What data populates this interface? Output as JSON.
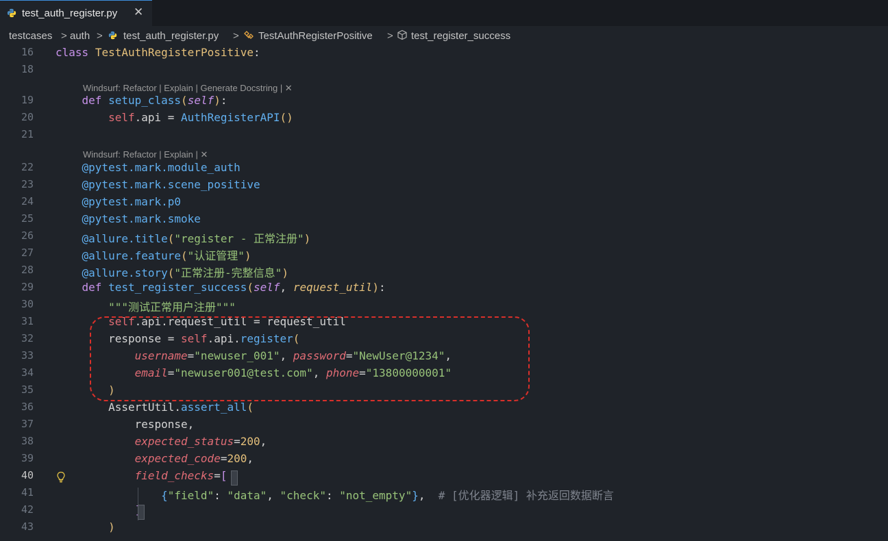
{
  "tab": {
    "title": "test_auth_register.py",
    "close": "✕"
  },
  "breadcrumb": {
    "folder1": "testcases",
    "folder2": "auth",
    "file": "test_auth_register.py",
    "class": "TestAuthRegisterPositive",
    "method": "test_register_success",
    "sep": ">"
  },
  "codelens": {
    "setup": "Windsurf: Refactor | Explain | Generate Docstring | ✕",
    "test": "Windsurf: Refactor | Explain | ✕"
  },
  "lines": {
    "l16": {
      "num": "16"
    },
    "l18": {
      "num": "18"
    },
    "l19": {
      "num": "19"
    },
    "l20": {
      "num": "20"
    },
    "l21": {
      "num": "21"
    },
    "l22": {
      "num": "22"
    },
    "l23": {
      "num": "23"
    },
    "l24": {
      "num": "24"
    },
    "l25": {
      "num": "25"
    },
    "l26": {
      "num": "26"
    },
    "l27": {
      "num": "27"
    },
    "l28": {
      "num": "28"
    },
    "l29": {
      "num": "29"
    },
    "l30": {
      "num": "30"
    },
    "l31": {
      "num": "31"
    },
    "l32": {
      "num": "32"
    },
    "l33": {
      "num": "33"
    },
    "l34": {
      "num": "34"
    },
    "l35": {
      "num": "35"
    },
    "l36": {
      "num": "36"
    },
    "l37": {
      "num": "37"
    },
    "l38": {
      "num": "38"
    },
    "l39": {
      "num": "39"
    },
    "l40": {
      "num": "40"
    },
    "l41": {
      "num": "41"
    },
    "l42": {
      "num": "42"
    },
    "l43": {
      "num": "43"
    }
  },
  "code": {
    "class_kw": "class",
    "class_name": "TestAuthRegisterPositive",
    "colon": ":",
    "def_kw": "def",
    "setup_name": "setup_class",
    "self_param": "self",
    "self_kw": "self",
    "api_attr": ".api = ",
    "api_class": "AuthRegisterAPI",
    "parens": "()",
    "dec1": "@pytest.mark.module_auth",
    "dec2": "@pytest.mark.scene_positive",
    "dec3": "@pytest.mark.p0",
    "dec4": "@pytest.mark.smoke",
    "dec5_name": "@allure.title",
    "dec5_arg": "\"register - 正常注册\"",
    "dec6_name": "@allure.feature",
    "dec6_arg": "\"认证管理\"",
    "dec7_name": "@allure.story",
    "dec7_arg": "\"正常注册-完整信息\"",
    "test_name": "test_register_success",
    "request_util_param": "request_util",
    "docstring": "\"\"\"测试正常用户注册\"\"\"",
    "line31_rest": ".api.request_util = request_util",
    "response_assign": "response = ",
    "api_dot": ".api.",
    "register_fn": "register",
    "username_kw": "username",
    "username_val": "\"newuser_001\"",
    "password_kw": "password",
    "password_val": "\"NewUser@1234\"",
    "email_kw": "email",
    "email_val": "\"newuser001@test.com\"",
    "phone_kw": "phone",
    "phone_val": "\"13800000001\"",
    "assert_util": "AssertUtil.",
    "assert_all": "assert_all",
    "response_arg": "response,",
    "expected_status": "expected_status",
    "status_val": "200",
    "expected_code": "expected_code",
    "code_val": "200",
    "field_checks": "field_checks",
    "field_key": "\"field\"",
    "field_val": "\"data\"",
    "check_key": "\"check\"",
    "check_val": "\"not_empty\"",
    "comment": "# [优化器逻辑] 补充返回数据断言"
  }
}
